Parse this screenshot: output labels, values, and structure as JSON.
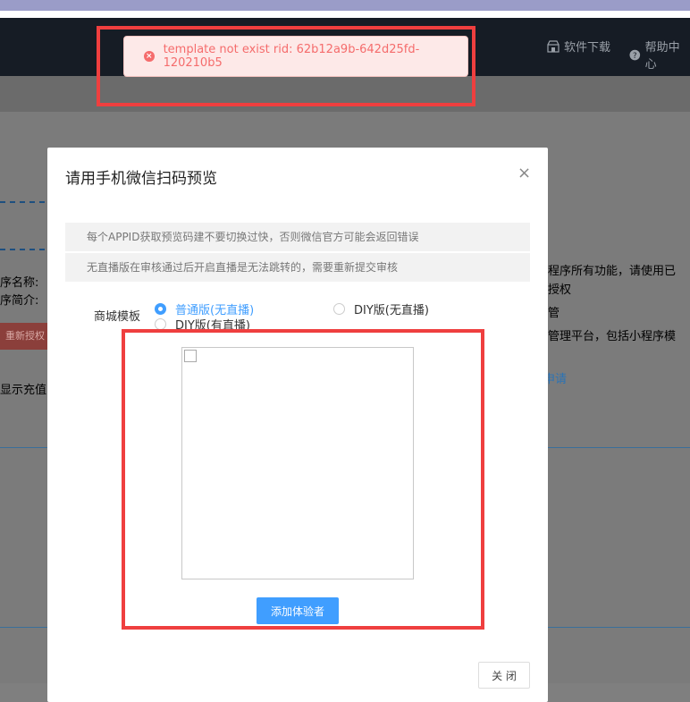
{
  "header": {
    "download_label": "软件下载",
    "help_label": "帮助中心"
  },
  "background": {
    "name_label": "序名称:",
    "intro_label": "序简介:",
    "reauth_button": "重新授权",
    "recharge_text": "显示充值",
    "right_line1": "程序所有功能，请使用已",
    "right_line2": "授权",
    "right_line3": "管",
    "right_line4": "管理平台，包括小程序模",
    "apply_link": "申请"
  },
  "toast": {
    "message": "template not exist rid: 62b12a9b-642d25fd-120210b5"
  },
  "modal": {
    "title": "请用手机微信扫码预览",
    "notices": [
      "每个APPID获取预览码建不要切换过快，否则微信官方可能会返回错误",
      "无直播版在审核通过后开启直播是无法跳转的，需要重新提交审核"
    ],
    "template_label": "商城模板",
    "options": [
      {
        "label": "普通版(无直播)",
        "checked": true
      },
      {
        "label": "DIY版(无直播)",
        "checked": false
      },
      {
        "label": "DIY版(有直播)",
        "checked": false
      }
    ],
    "add_tester_button": "添加体验者",
    "close_button": "关 闭"
  },
  "colors": {
    "accent": "#409eff",
    "error": "#f56c6c",
    "highlight": "#ef3f3f"
  }
}
